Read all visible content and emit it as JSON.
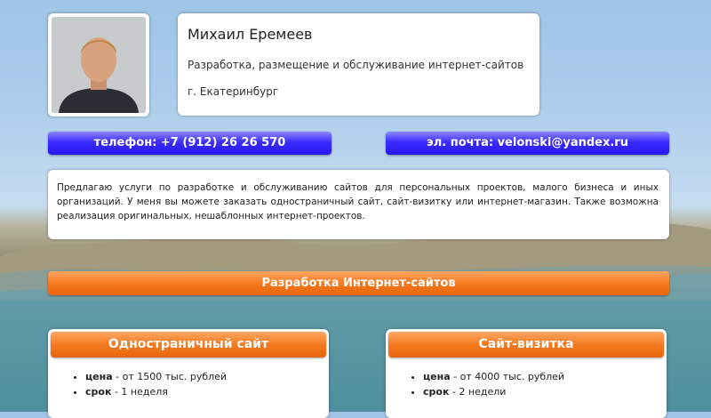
{
  "profile": {
    "name": "Михаил Еремеев",
    "tagline": "Разработка, размещение и обслуживание интернет-сайтов",
    "city": "г. Екатеринбург"
  },
  "contacts": {
    "phone": "телефон: +7 (912) 26 26 570",
    "email": "эл. почта: velonski@yandex.ru"
  },
  "about": "Предлагаю услуги по разработке и обслуживанию сайтов для персональных проектов, малого бизнеса и иных организаций. У меня вы можете заказать одностраничный сайт, сайт-визитку или интернет-магазин. Также возможна реализация оригинальных, нешаблонных интернет-проектов.",
  "section_title": "Разработка Интернет-сайтов",
  "offers": [
    {
      "title": "Одностраничный сайт",
      "price_label": "цена",
      "price": " - от 1500 тыс. рублей",
      "term_label": "срок",
      "term": " - 1 неделя"
    },
    {
      "title": "Сайт-визитка",
      "price_label": "цена",
      "price": " - от 4000 тыс. рублей",
      "term_label": "срок",
      "term": " - 2 недели"
    }
  ],
  "colors": {
    "contact_button": "#3a2cff",
    "orange_bar": "#f47a1f"
  }
}
